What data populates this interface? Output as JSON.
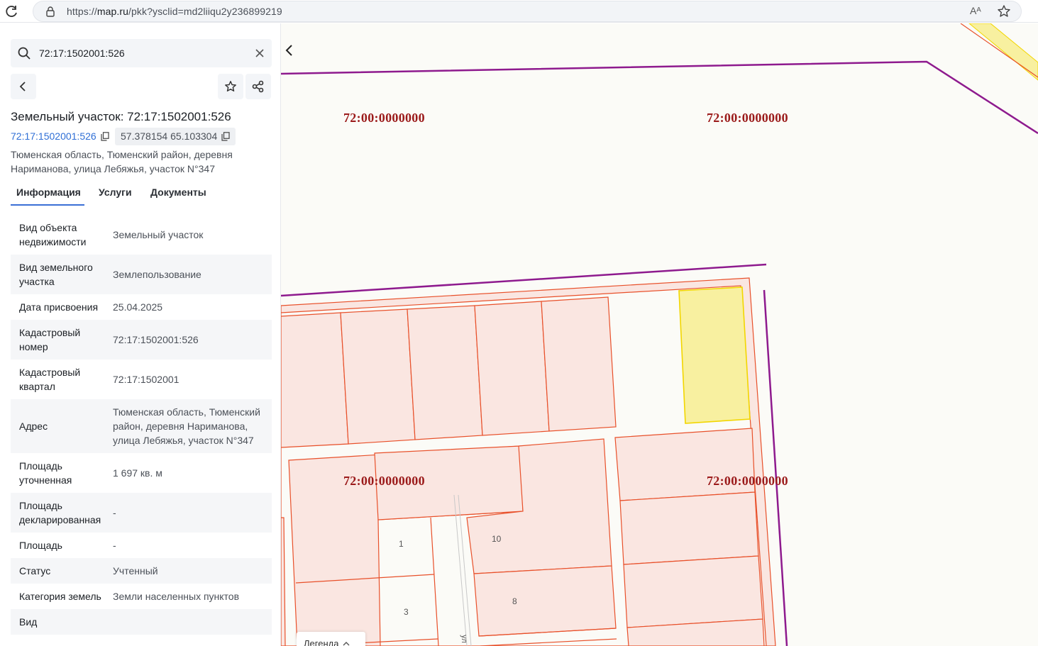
{
  "browser": {
    "url_prefix": "https://",
    "url_host": "map.ru",
    "url_path": "/pkk?ysclid=md2liiqu2y236899219",
    "read_aloud_label": "Aᴬ"
  },
  "sidebar": {
    "search": {
      "value": "72:17:1502001:526"
    },
    "title": "Земельный участок: 72:17:1502001:526",
    "cadastral_link": "72:17:1502001:526",
    "coordinates": "57.378154 65.103304",
    "address": "Тюменская область, Тюменский район, деревня Нариманова, улица Лебяжья, участок N°347",
    "tabs": [
      {
        "label": "Информация",
        "active": true
      },
      {
        "label": "Услуги",
        "active": false
      },
      {
        "label": "Документы",
        "active": false
      }
    ],
    "rows": [
      {
        "label": "Вид объекта недвижимости",
        "value": "Земельный участок"
      },
      {
        "label": "Вид земельного участка",
        "value": "Землепользование"
      },
      {
        "label": "Дата присвоения",
        "value": "25.04.2025"
      },
      {
        "label": "Кадастровый номер",
        "value": "72:17:1502001:526"
      },
      {
        "label": "Кадастровый квартал",
        "value": "72:17:1502001"
      },
      {
        "label": "Адрес",
        "value": "Тюменская область, Тюменский район, деревня Нариманова, улица Лебяжья, участок N°347"
      },
      {
        "label": "Площадь уточненная",
        "value": "1 697 кв. м"
      },
      {
        "label": "Площадь декларированная",
        "value": "-"
      },
      {
        "label": "Площадь",
        "value": "-"
      },
      {
        "label": "Статус",
        "value": "Учтенный"
      },
      {
        "label": "Категория земель",
        "value": "Земли населенных пунктов"
      },
      {
        "label": "Вид",
        "value": ""
      }
    ]
  },
  "map": {
    "quarter_labels": [
      "72:00:0000000",
      "72:00:0000000",
      "72:00:0000000",
      "72:00:0000000"
    ],
    "parcel_numbers": [
      "1",
      "10",
      "3",
      "8"
    ],
    "street_label": "ул",
    "legend_label": "Легенда",
    "colors": {
      "quarter_border": "#8e1a8e",
      "parcel_border": "#e8502a",
      "parcel_fill": "#fae6e1",
      "selected_fill": "#f8f0a0",
      "selected_border": "#f2d600",
      "quarter_label": "#9b1a1a",
      "link": "#2f6fd6"
    }
  }
}
